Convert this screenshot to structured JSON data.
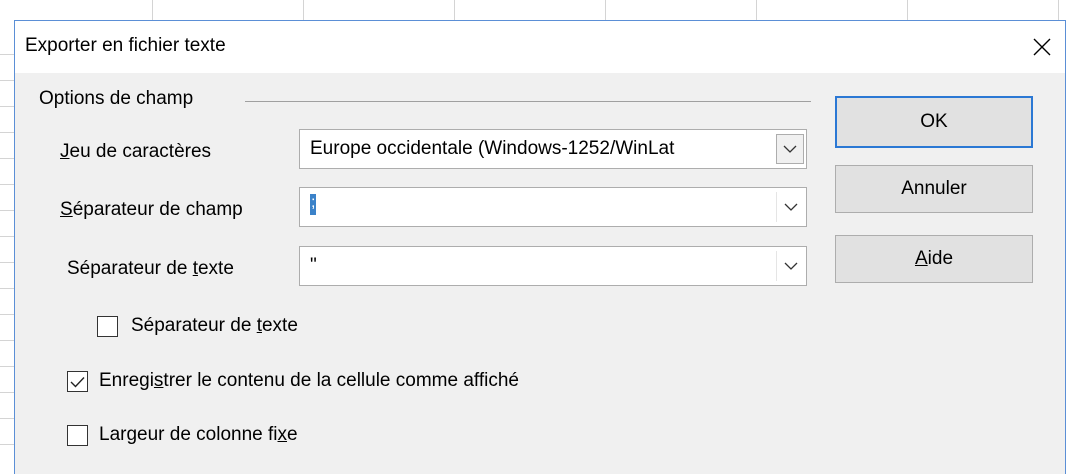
{
  "dialog": {
    "title": "Exporter en fichier texte",
    "close_glyph": "close-icon"
  },
  "group": {
    "title": "Options de champ"
  },
  "fields": {
    "charset": {
      "label_prefix": "J",
      "label_rest": "eu de caractères",
      "value": "Europe occidentale (Windows-1252/WinLat"
    },
    "field_separator": {
      "label_prefix": "S",
      "label_rest": "éparateur de champ",
      "value": ";"
    },
    "text_separator": {
      "label_before": "Séparateur de ",
      "label_accel": "t",
      "label_after": "exte",
      "value": "\""
    }
  },
  "checkboxes": {
    "text_sep": {
      "label_before": "Séparateur de ",
      "label_accel": "t",
      "label_after": "exte",
      "checked": false
    },
    "save_as_shown": {
      "label_before": "Enregi",
      "label_accel": "s",
      "label_after": "trer le contenu de la cellule comme affiché",
      "checked": true
    },
    "fixed_width": {
      "label_before": "Largeur de colonne fi",
      "label_accel": "x",
      "label_after": "e",
      "checked": false
    }
  },
  "buttons": {
    "ok": "OK",
    "cancel": "Annuler",
    "help_accel": "A",
    "help_rest": "ide"
  },
  "colors": {
    "accent": "#2b78d4",
    "dialog_bg": "#f0f0f0",
    "button_bg": "#e1e1e1"
  }
}
